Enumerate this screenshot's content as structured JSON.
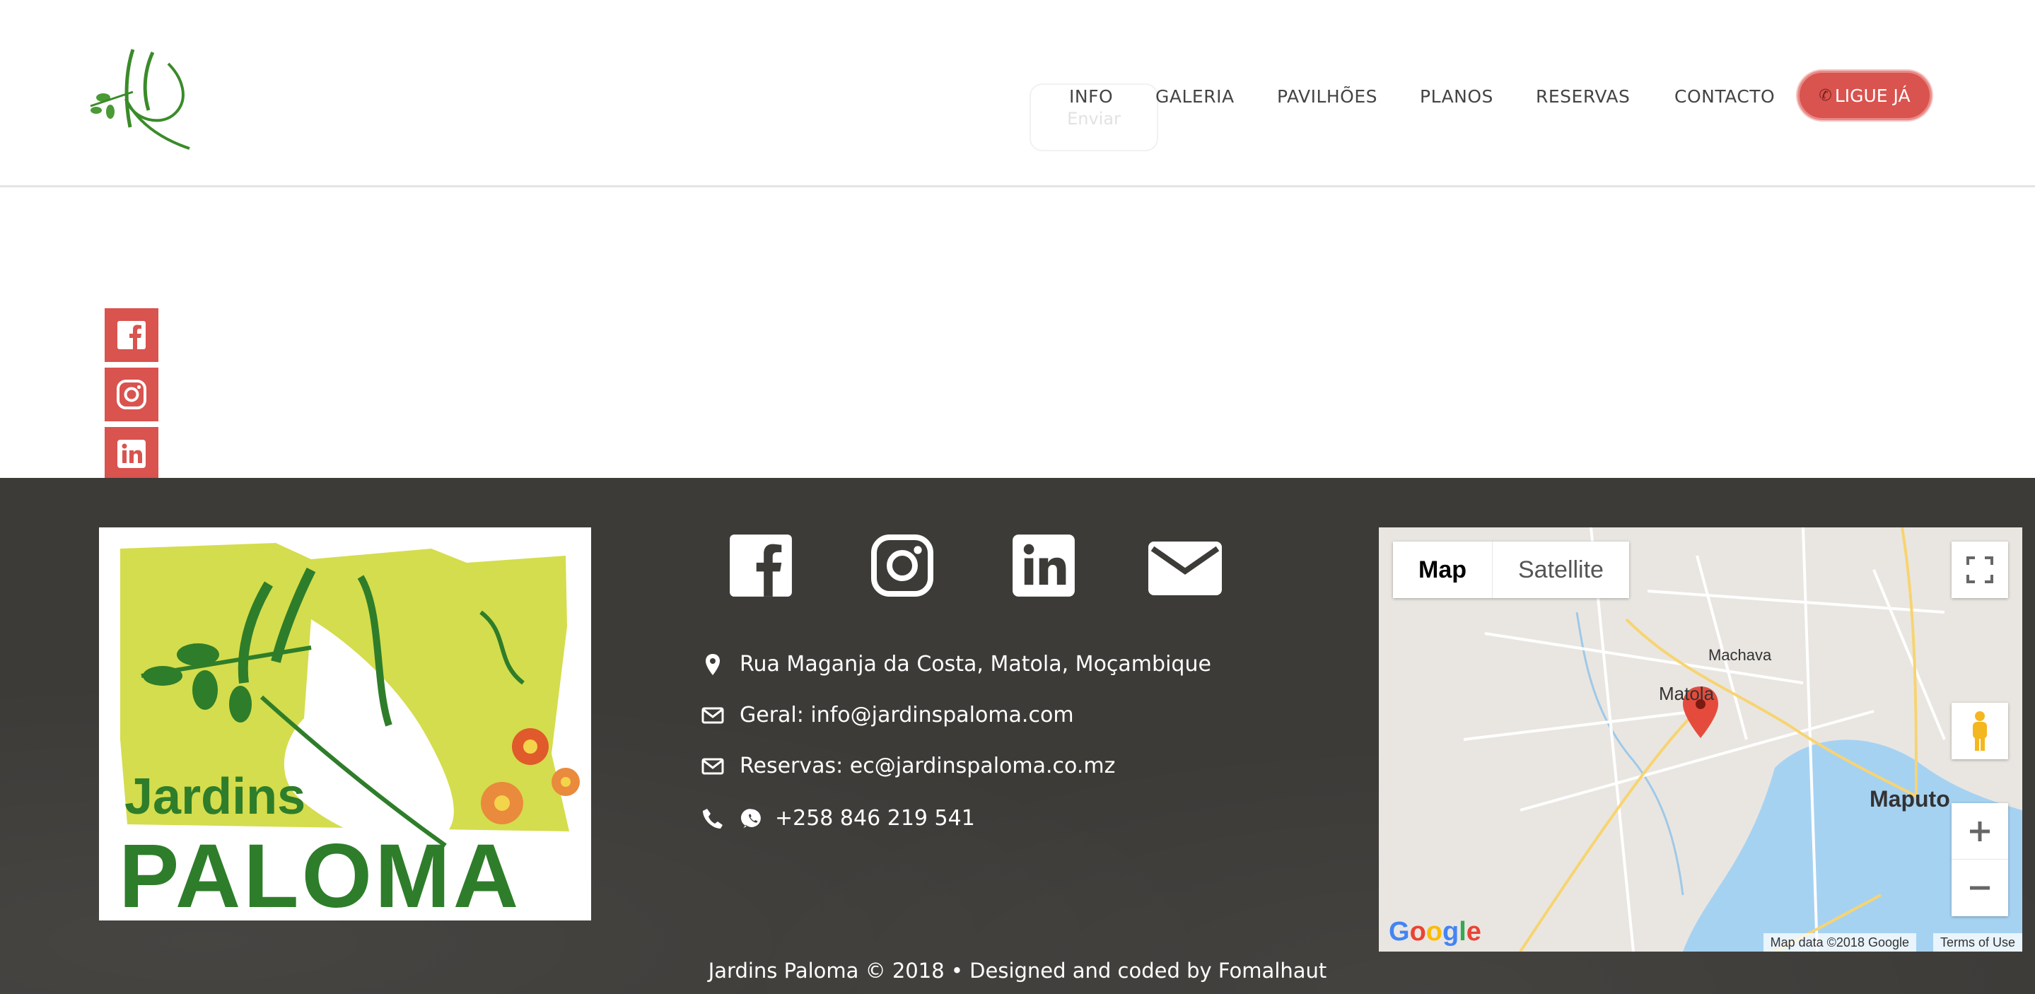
{
  "header": {
    "nav": [
      {
        "label": "INFO"
      },
      {
        "label": "GALERIA"
      },
      {
        "label": "PAVILHÕES"
      },
      {
        "label": "PLANOS"
      },
      {
        "label": "RESERVAS"
      },
      {
        "label": "CONTACTO"
      }
    ],
    "cta_label": "LIGUE JÁ",
    "ghost_button_label": "Enviar"
  },
  "side_social": [
    "facebook-icon",
    "instagram-icon",
    "linkedin-icon",
    "mail-icon",
    "whatsapp-icon"
  ],
  "footer": {
    "logo_text_1": "Jardins",
    "logo_text_2": "PALOMA",
    "social": [
      "facebook-icon",
      "instagram-icon",
      "linkedin-icon",
      "mail-icon"
    ],
    "address": "Rua Maganja da Costa, Matola, Moçambique",
    "email_general": "Geral: info@jardinspaloma.com",
    "email_reservations": "Reservas: ec@jardinspaloma.co.mz",
    "phone": "+258 846 219 541",
    "copyright": "Jardins Paloma © 2018 • Designed and coded by Fomalhaut"
  },
  "map": {
    "tab_map": "Map",
    "tab_satellite": "Satellite",
    "label_machava": "Machava",
    "label_matola": "Matola",
    "label_maputo": "Maputo",
    "attribution": "Map data ©2018 Google",
    "terms": "Terms of Use",
    "google": "Google"
  },
  "colors": {
    "accent": "#d9534f",
    "footer_bg": "#3d3b38",
    "brand_green": "#2e7d2a",
    "logo_lime": "#d4dd4d"
  }
}
